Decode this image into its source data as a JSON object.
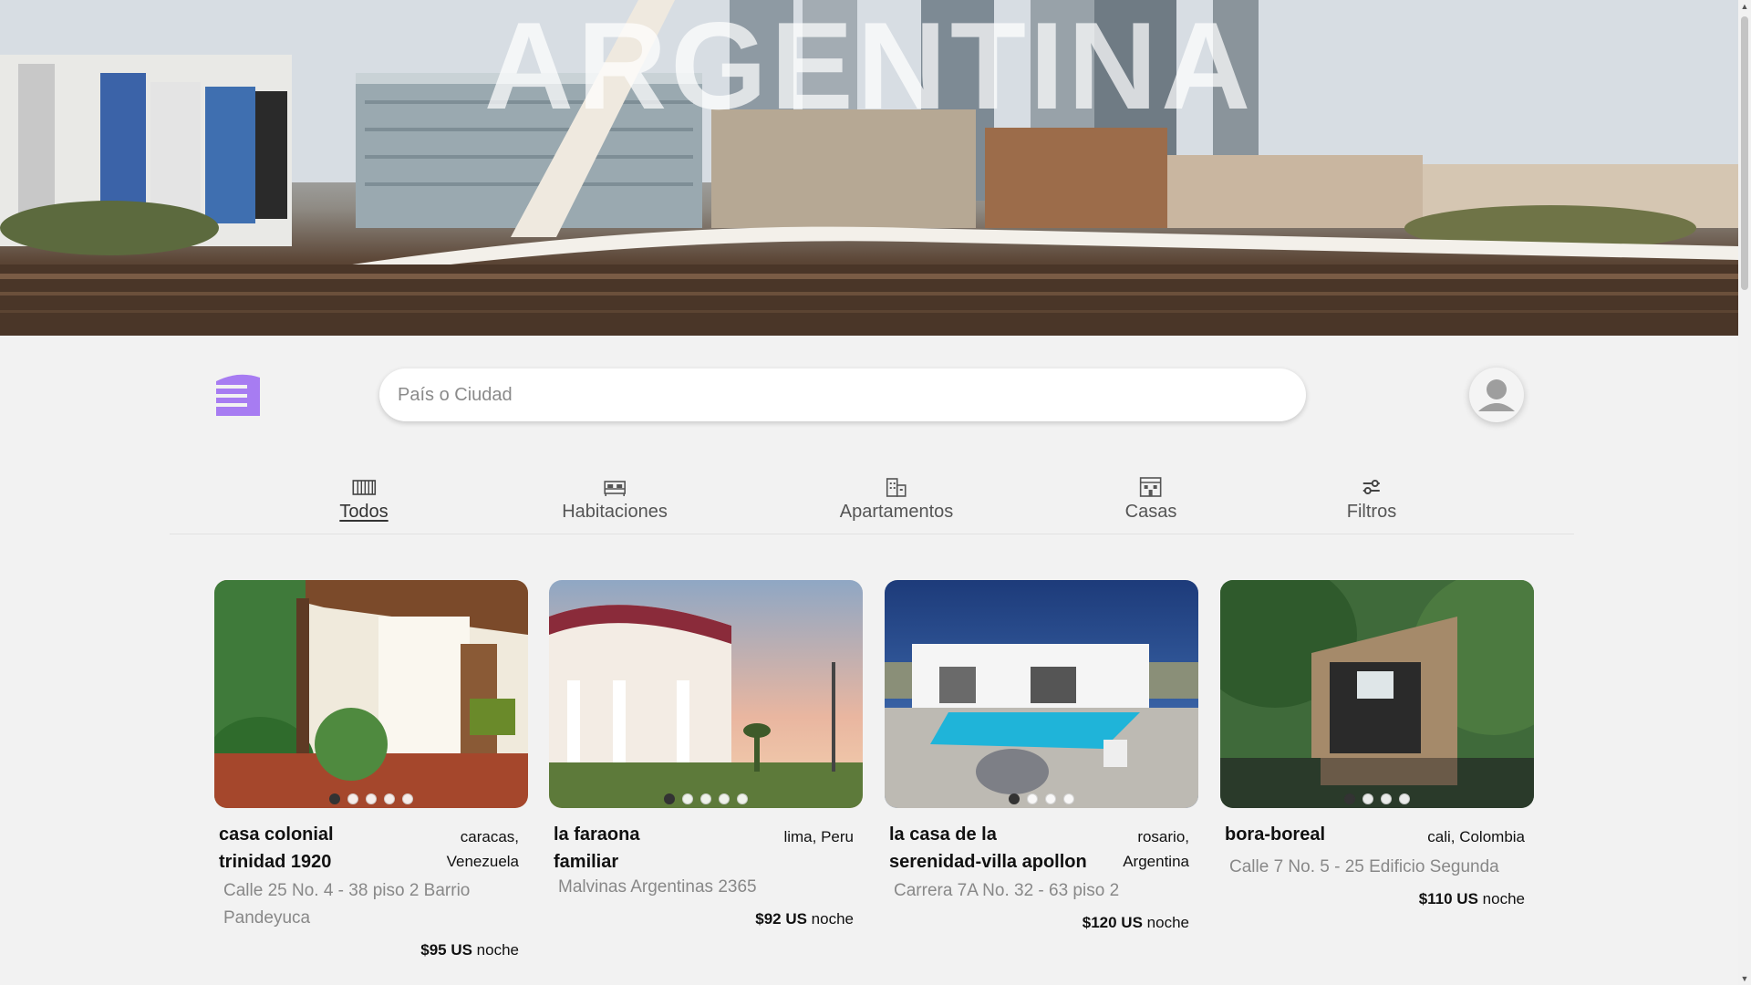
{
  "hero": {
    "title": "ARGENTINA"
  },
  "search": {
    "placeholder": "País o Ciudad"
  },
  "tabs": [
    {
      "label": "Todos",
      "icon": "grid-icon",
      "active": true
    },
    {
      "label": "Habitaciones",
      "icon": "bed-icon",
      "active": false
    },
    {
      "label": "Apartamentos",
      "icon": "building-icon",
      "active": false
    },
    {
      "label": "Casas",
      "icon": "house-icon",
      "active": false
    },
    {
      "label": "Filtros",
      "icon": "sliders-icon",
      "active": false
    }
  ],
  "cards": [
    {
      "title_line1": "casa colonial",
      "title_line2": "trinidad 1920",
      "loc_line1": "caracas,",
      "loc_line2": "Venezuela",
      "addr_line1": "Calle 25 No. 4 - 38 piso 2 Barrio",
      "addr_line2": "Pandeyuca",
      "price": "$95 US",
      "unit": "noche",
      "image_index": 1
    },
    {
      "title_line1": "la faraona",
      "title_line2": "familiar",
      "loc_line1": "lima, Peru",
      "loc_line2": "",
      "addr_line1": "Malvinas Argentinas 2365",
      "addr_line2": "",
      "price": "$92 US",
      "unit": "noche",
      "image_index": 1
    },
    {
      "title_line1": "la casa de la",
      "title_line2": "serenidad-villa apollon",
      "loc_line1": "rosario,",
      "loc_line2": "Argentina",
      "addr_line1": "Carrera 7A No. 32 - 63 piso 2",
      "addr_line2": "",
      "price": "$120 US",
      "unit": "noche",
      "image_index": 1
    },
    {
      "title_line1": "bora-boreal",
      "title_line2": "",
      "loc_line1": "cali, Colombia",
      "loc_line2": "",
      "addr_line1": "Calle 7 No. 5 - 25 Edificio Segunda",
      "addr_line2": "",
      "price": "$110 US",
      "unit": "noche",
      "image_index": 1
    }
  ],
  "colors": {
    "brand": "#9b6cf0",
    "background": "#f2f2f2"
  }
}
